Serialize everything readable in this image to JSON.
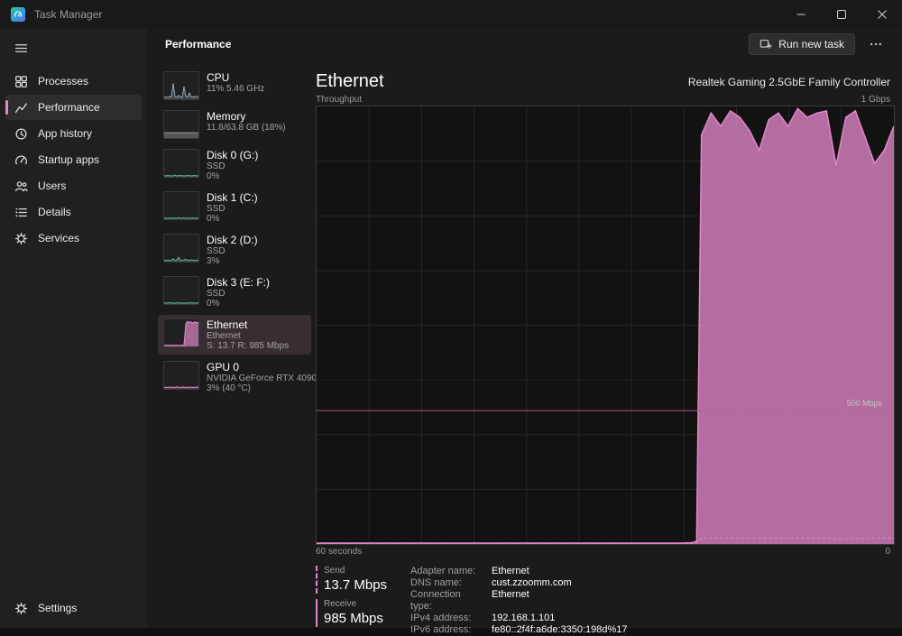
{
  "colors": {
    "accent": "#e287c9",
    "accent_fill_opacity": 0.78,
    "ref_line": "#b4638f",
    "grid_line": "#262626",
    "chart_background": "#121212"
  },
  "titlebar": {
    "title": "Task Manager"
  },
  "sidebar": {
    "items": [
      {
        "label": "Processes"
      },
      {
        "label": "Performance"
      },
      {
        "label": "App history"
      },
      {
        "label": "Startup apps"
      },
      {
        "label": "Users"
      },
      {
        "label": "Details"
      },
      {
        "label": "Services"
      }
    ],
    "settings": {
      "label": "Settings"
    }
  },
  "header": {
    "title": "Performance",
    "run_new_task_label": "Run new task"
  },
  "perf": {
    "items": [
      {
        "title": "CPU",
        "line1": "11% 5.46 GHz",
        "line2": "",
        "spark": {
          "max": 100,
          "color": "#9aa8b2",
          "fill_opacity": 0.25,
          "values": [
            4,
            6,
            3,
            8,
            4,
            62,
            7,
            4,
            12,
            6,
            3,
            48,
            8,
            5,
            22,
            6,
            4,
            9,
            5,
            7
          ]
        }
      },
      {
        "title": "Memory",
        "line1": "11.8/63.8 GB (18%)",
        "line2": "",
        "spark": {
          "max": 100,
          "color": "#9a9a9a",
          "fill_opacity": 0.45,
          "values": [
            18,
            18,
            18,
            18,
            18,
            18,
            18,
            18,
            18,
            18,
            18,
            18,
            18,
            18,
            18,
            18,
            18,
            18,
            18,
            18
          ]
        }
      },
      {
        "title": "Disk 0 (G:)",
        "line1": "SSD",
        "line2": "0%",
        "spark": {
          "max": 100,
          "color": "#63b0a2",
          "fill_opacity": 0.3,
          "values": [
            1,
            0,
            2,
            1,
            0,
            1,
            3,
            0,
            1,
            2,
            0,
            1,
            0,
            2,
            1,
            0,
            1,
            2,
            0,
            1
          ]
        }
      },
      {
        "title": "Disk 1 (C:)",
        "line1": "SSD",
        "line2": "0%",
        "spark": {
          "max": 100,
          "color": "#63b0a2",
          "fill_opacity": 0.3,
          "values": [
            0,
            1,
            0,
            2,
            1,
            0,
            1,
            0,
            3,
            1,
            0,
            2,
            1,
            0,
            1,
            0,
            2,
            1,
            0,
            1
          ]
        }
      },
      {
        "title": "Disk 2 (D:)",
        "line1": "SSD",
        "line2": "3%",
        "spark": {
          "max": 100,
          "color": "#63b0a2",
          "fill_opacity": 0.3,
          "values": [
            2,
            1,
            3,
            1,
            2,
            8,
            1,
            2,
            14,
            2,
            1,
            3,
            6,
            2,
            1,
            4,
            2,
            1,
            3,
            2
          ]
        }
      },
      {
        "title": "Disk 3 (E: F:)",
        "line1": "SSD",
        "line2": "0%",
        "spark": {
          "max": 100,
          "color": "#63b0a2",
          "fill_opacity": 0.3,
          "values": [
            1,
            0,
            1,
            2,
            0,
            1,
            0,
            1,
            2,
            0,
            1,
            0,
            1,
            0,
            2,
            1,
            0,
            1,
            0,
            1
          ]
        }
      },
      {
        "title": "Ethernet",
        "line1": "Ethernet",
        "line2": "S: 13.7 R: 985 Mbps",
        "spark": {
          "max": 100,
          "color": "#e287c9",
          "fill_opacity": 0.7,
          "values": [
            1,
            1,
            1,
            1,
            1,
            1,
            1,
            1,
            1,
            1,
            1,
            1,
            90,
            99,
            95,
            97,
            92,
            98,
            94,
            96
          ]
        }
      },
      {
        "title": "GPU 0",
        "line1": "NVIDIA GeForce RTX 4090",
        "line2": "3% (40 °C)",
        "spark": {
          "max": 100,
          "color": "#e287c9",
          "fill_opacity": 0.3,
          "values": [
            2,
            3,
            2,
            4,
            3,
            2,
            3,
            5,
            3,
            2,
            4,
            3,
            2,
            3,
            4,
            2,
            3,
            2,
            4,
            3
          ]
        }
      }
    ]
  },
  "detail": {
    "title": "Ethernet",
    "subtitle": "Realtek Gaming 2.5GbE Family Controller",
    "stats": {
      "send_label": "Send",
      "send_value": "13.7 Mbps",
      "receive_label": "Receive",
      "receive_value": "985 Mbps"
    },
    "fields": [
      {
        "label": "Adapter name:",
        "value": "Ethernet"
      },
      {
        "label": "DNS name:",
        "value": "cust.zzoomm.com"
      },
      {
        "label": "Connection type:",
        "value": "Ethernet"
      },
      {
        "label": "IPv4 address:",
        "value": "192.168.1.101"
      },
      {
        "label": "IPv6 address:",
        "value": "fe80::2f4f:a6de:3350:198d%17"
      }
    ]
  },
  "chart_data": {
    "type": "area",
    "title": "Ethernet Throughput",
    "ylabel": "Throughput",
    "x_axis": {
      "left_label": "60 seconds",
      "right_label": "0",
      "range_seconds": [
        60,
        0
      ]
    },
    "y_axis": {
      "top_label": "1 Gbps",
      "unit": "Mbps",
      "ylim": [
        0,
        1000
      ]
    },
    "ref_line": {
      "value": 500,
      "label": "500 Mbps",
      "y_frac": 0.695
    },
    "grid": true,
    "series": [
      {
        "name": "Receive",
        "style": "filled",
        "current": "985 Mbps",
        "x_seconds_ago": [
          60,
          50,
          40,
          30,
          25,
          22,
          21,
          20.5,
          20,
          19,
          18,
          17,
          16,
          15,
          14,
          13,
          12,
          11,
          10,
          9,
          8,
          7,
          6,
          5,
          4,
          3,
          2,
          1,
          0
        ],
        "values_mbps": [
          2,
          2,
          2,
          2,
          2,
          2,
          3,
          6,
          935,
          985,
          955,
          990,
          975,
          945,
          900,
          970,
          985,
          955,
          995,
          975,
          985,
          990,
          865,
          975,
          990,
          930,
          870,
          900,
          955
        ]
      },
      {
        "name": "Send",
        "style": "dashed",
        "current": "13.7 Mbps",
        "x_seconds_ago": [
          60,
          50,
          40,
          30,
          25,
          21,
          20.5,
          20,
          15,
          10,
          5,
          0
        ],
        "values_mbps": [
          1,
          1,
          1,
          1,
          1,
          1,
          2,
          14,
          13,
          14,
          12,
          14
        ]
      }
    ]
  }
}
